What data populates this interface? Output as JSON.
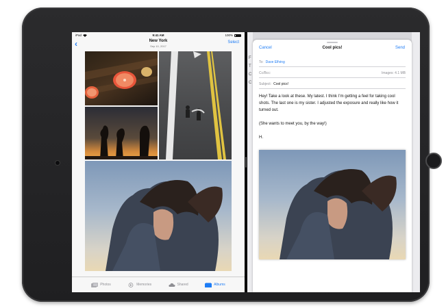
{
  "status_bar": {
    "carrier": "iPad",
    "time": "9:41 AM",
    "battery": "100%"
  },
  "photos": {
    "nav": {
      "title": "New York",
      "subtitle": "Sep 10, 2017",
      "select_label": "Select"
    },
    "tabs": [
      {
        "label": "Photos",
        "icon": "photos-icon"
      },
      {
        "label": "Memories",
        "icon": "memories-icon"
      },
      {
        "label": "Shared",
        "icon": "cloud-icon"
      },
      {
        "label": "Albums",
        "icon": "albums-icon",
        "active": true
      }
    ]
  },
  "mail": {
    "background_letters": [
      "F",
      "T",
      "C",
      "C"
    ],
    "compose": {
      "cancel_label": "Cancel",
      "title": "Cool pics!",
      "send_label": "Send",
      "to_label": "To:",
      "to_value": "Dave Elfving",
      "cc_label": "Cc/Bcc:",
      "images_info": "Images: 4.1 MB",
      "subject_label": "Subject:",
      "subject_value": "Cool pics!",
      "body": [
        "Hey! Take a look at these. My latest. I think I’m getting a feel for taking cool shots. The last one is my sister. I adjusted the exposure and really like how it turned out.",
        "(She wants to meet you, by the way!)",
        "H."
      ]
    }
  },
  "colors": {
    "accent": "#1e7cf5",
    "device": "#232325"
  }
}
